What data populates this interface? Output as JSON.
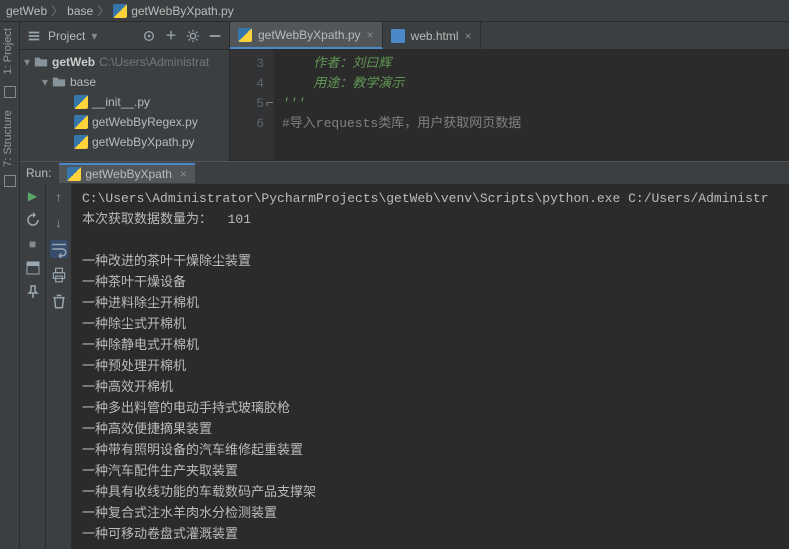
{
  "breadcrumb": {
    "root": "getWeb",
    "mid": "base",
    "file": "getWebByXpath.py"
  },
  "left_tabs": {
    "project": "1: Project",
    "structure": "7: Structure"
  },
  "project_panel": {
    "title": "Project",
    "root_label": "getWeb",
    "root_path": "C:\\Users\\Administrat",
    "folder": "base",
    "files": [
      "__init__.py",
      "getWebByRegex.py",
      "getWebByXpath.py"
    ]
  },
  "editor": {
    "tabs": [
      {
        "label": "getWebByXpath.py",
        "active": true
      },
      {
        "label": "web.html",
        "active": false
      }
    ],
    "gutter": [
      "3",
      "4",
      "5",
      "6"
    ],
    "lines": [
      {
        "cls": "green",
        "text": "    作者：刘曰辉"
      },
      {
        "cls": "green",
        "text": "    用途：教学演示"
      },
      {
        "cls": "green",
        "text": "'''"
      },
      {
        "cls": "gray",
        "text": "#导入requests类库，用户获取网页数据"
      }
    ]
  },
  "run": {
    "title": "Run:",
    "tab_label": "getWebByXpath",
    "cmd": "C:\\Users\\Administrator\\PycharmProjects\\getWeb\\venv\\Scripts\\python.exe C:/Users/Administr",
    "count_line": "本次获取数据数量为：  101",
    "items": [
      "一种改进的茶叶干燥除尘装置",
      "一种茶叶干燥设备",
      "一种进料除尘开棉机",
      "一种除尘式开棉机",
      "一种除静电式开棉机",
      "一种预处理开棉机",
      "一种高效开棉机",
      "一种多出料管的电动手持式玻璃胶枪",
      "一种高效便捷摘果装置",
      "一种带有照明设备的汽车维修起重装置",
      "一种汽车配件生产夹取装置",
      "一种具有收线功能的车载数码产品支撑架",
      "一种复合式注水羊肉水分检测装置",
      "一种可移动卷盘式灌溉装置"
    ]
  },
  "icons": {
    "gear": "gear-icon",
    "collapse": "collapse-icon",
    "target": "target-icon",
    "expand": "expand-icon",
    "minus": "minus-icon",
    "run": "run-icon",
    "stop": "stop-icon",
    "restart": "restart-icon",
    "up": "up-arrow-icon",
    "down": "down-arrow-icon",
    "wrap": "wrap-icon",
    "print": "print-icon",
    "trash": "trash-icon",
    "pin": "pin-icon"
  }
}
